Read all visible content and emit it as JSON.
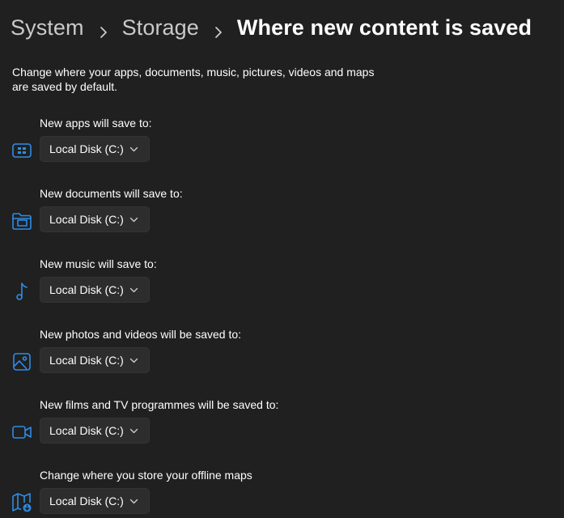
{
  "breadcrumb": {
    "items": [
      "System",
      "Storage",
      "Where new content is saved"
    ]
  },
  "description": "Change where your apps, documents, music, pictures, videos and maps are saved by default.",
  "accent_color": "#2f8ce6",
  "settings": [
    {
      "label": "New apps will save to:",
      "value": "Local Disk (C:)",
      "icon": "apps-icon"
    },
    {
      "label": "New documents will save to:",
      "value": "Local Disk (C:)",
      "icon": "documents-folder-icon"
    },
    {
      "label": "New music will save to:",
      "value": "Local Disk (C:)",
      "icon": "music-note-icon"
    },
    {
      "label": "New photos and videos will be saved to:",
      "value": "Local Disk (C:)",
      "icon": "photo-icon"
    },
    {
      "label": "New films and TV programmes will be saved to:",
      "value": "Local Disk (C:)",
      "icon": "video-camera-icon"
    },
    {
      "label": "Change where you store your offline maps",
      "value": "Local Disk (C:)",
      "icon": "offline-maps-icon"
    }
  ]
}
